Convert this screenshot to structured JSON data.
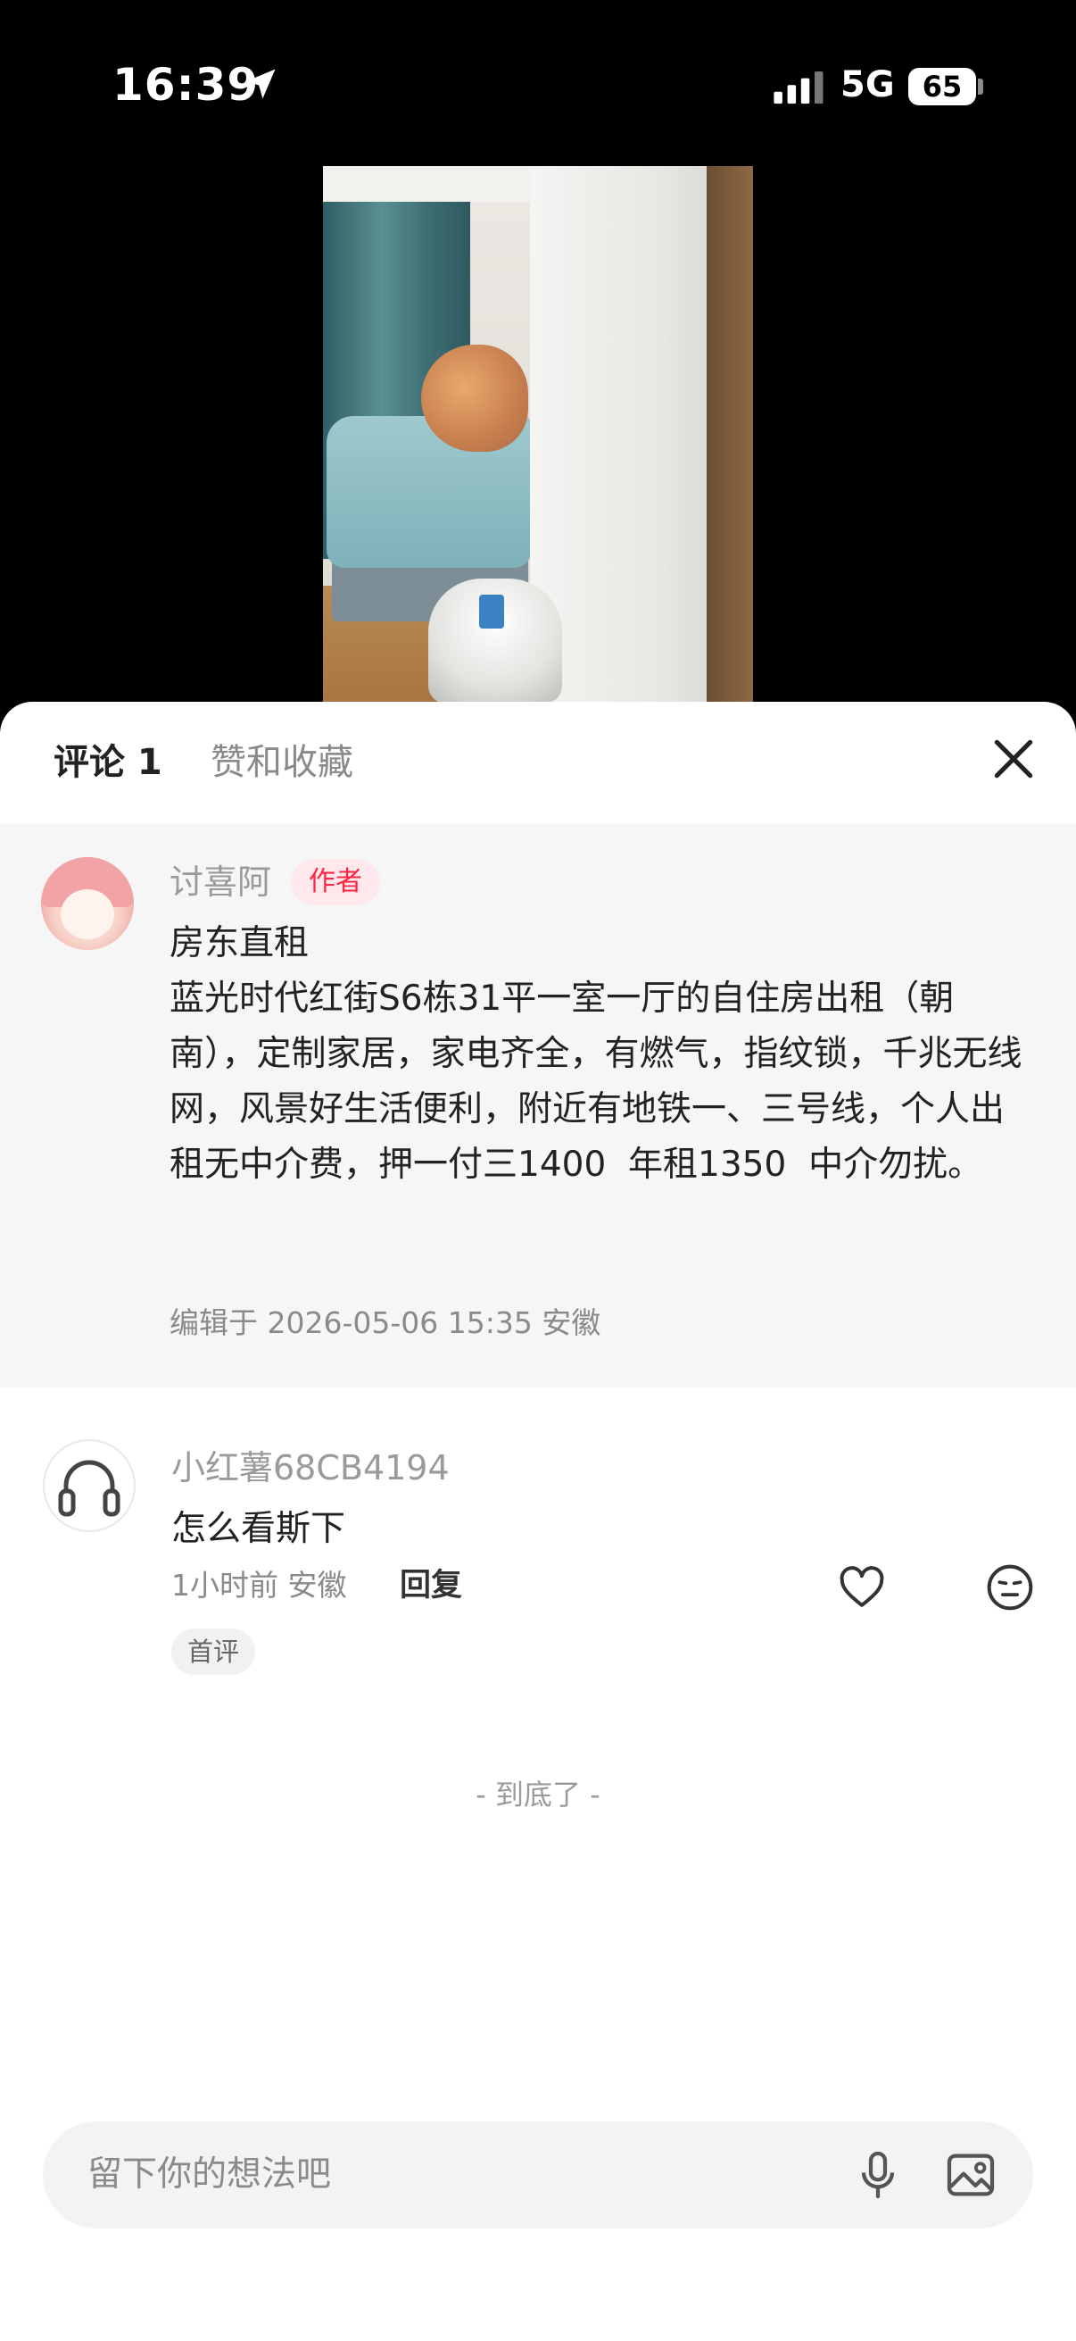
{
  "status_bar": {
    "time": "16:39",
    "network": "5G",
    "battery": "65"
  },
  "sheet": {
    "tabs": [
      {
        "label": "评论 1"
      },
      {
        "label": "赞和收藏"
      }
    ]
  },
  "pinned_comment": {
    "username": "讨喜阿",
    "badge": "作者",
    "body": "房东直租\n蓝光时代红街S6栋31平一室一厅的自住房出租（朝南），定制家居，家电齐全，有燃气，指纹锁，千兆无线网，风景好生活便利，附近有地铁一、三号线，个人出租无中介费，押一付三1400  年租1350  中介勿扰。",
    "meta": "编辑于  2026-05-06 15:35 安徽"
  },
  "comment": {
    "username": "小红薯68CB4194",
    "body": "怎么看斯下",
    "meta": "1小时前 安徽",
    "reply_label": "回复",
    "tag": "首评"
  },
  "end_marker": "- 到底了 -",
  "input": {
    "placeholder": "留下你的想法吧"
  },
  "colors": {
    "accent": "#ff2442",
    "text_primary": "#222222",
    "text_secondary": "#9a9a9a"
  },
  "icons": [
    "location-arrow-icon",
    "signal-icon",
    "close-icon",
    "headphones-icon",
    "heart-icon",
    "emoji-icon",
    "mic-icon",
    "image-icon"
  ]
}
